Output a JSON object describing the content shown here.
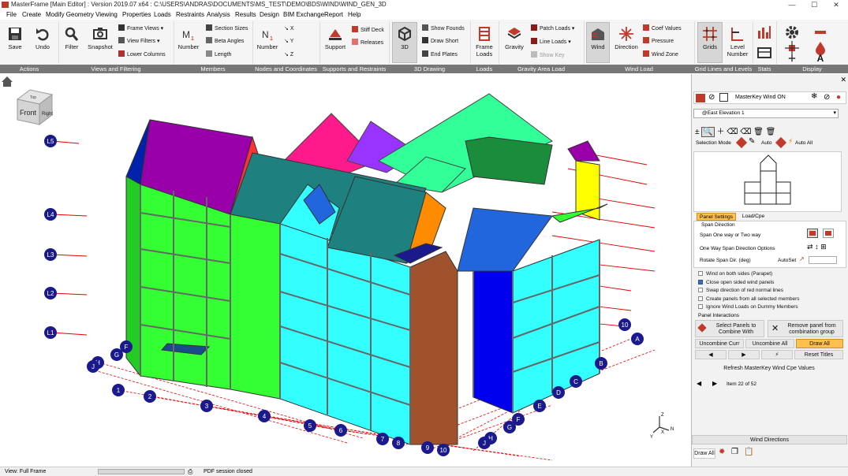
{
  "window": {
    "title": "MasterFrame [Main Editor] : Version 2019.07 x64 : C:\\USERS\\ANDRAS\\DOCUMENTS\\MS_TEST\\DEMO\\BDS\\WIND\\WIND_GEN_3D",
    "minimize": "—",
    "maximize": "☐",
    "close": "✕"
  },
  "menu": [
    "File",
    "Create",
    "Modify Geometry",
    "Viewing",
    "Properties",
    "Loads",
    "Restraints",
    "Analysis",
    "Results",
    "Design",
    "BIM Exchange",
    "Report",
    "Help"
  ],
  "ribbon": {
    "groups": [
      "Actions",
      "Views and Filtering",
      "Members",
      "Nodes and Coordinates",
      "Supports and Restraints",
      "3D Drawing",
      "Loads",
      "Gravity Area Load",
      "Wind Load",
      "Grid Lines and Levels",
      "Stats",
      "Display"
    ],
    "save": "Save",
    "undo": "Undo",
    "filter": "Filter",
    "snapshot": "Snapshot",
    "frame_views": "Frame Views",
    "view_filters": "View Filters",
    "lower_columns": "Lower Columns",
    "number_members": "Number",
    "section_sizes": "Section Sizes",
    "beta_angles": "Beta Angles",
    "length": "Length",
    "number_nodes": "Number",
    "support": "Support",
    "stiff_deck": "Stiff Deck",
    "releases": "Releases",
    "three_d": "3D",
    "show_founds": "Show Founds",
    "draw_short": "Draw Short",
    "end_plates": "End Plates",
    "frame_loads": "Frame Loads",
    "gravity": "Gravity",
    "patch_loads": "Patch Loads",
    "line_loads": "Line Loads",
    "show_key": "Show Key",
    "wind": "Wind",
    "direction": "Direction",
    "coef_values": "Coef Values",
    "pressure": "Pressure",
    "wind_zone": "Wind Zone",
    "grids": "Grids",
    "level_number": "Level Number"
  },
  "viewcube": {
    "top": "Top",
    "front": "Front",
    "right": "Right"
  },
  "levels": [
    "L5",
    "L4",
    "L3",
    "L2",
    "L1"
  ],
  "grid_numbers": [
    "1",
    "2",
    "3",
    "4",
    "5",
    "6",
    "7",
    "8",
    "9",
    "10"
  ],
  "grid_letters": [
    "A",
    "B",
    "C",
    "D",
    "E",
    "F",
    "G",
    "H",
    "J"
  ],
  "axes": {
    "x": "X",
    "y": "Y",
    "z": "Z",
    "n": "N"
  },
  "panel": {
    "title": "MasterKey Wind ON",
    "elevation": "@East Elevation 1",
    "selection_mode_label": "Selection Mode",
    "auto": "Auto",
    "auto_all": "Auto All",
    "tabs": [
      "Panel Settings",
      "Load/Cpe"
    ],
    "span_direction": "Span Direction",
    "span_one_or_two": "Span One way or Two way",
    "one_way_options": "One Way Span Direction Options",
    "rotate_span": "Rotate Span Dir. (deg)",
    "autoset": "AutoSet",
    "checkboxes": [
      {
        "label": "Wind on both sides (Parapet)",
        "checked": false
      },
      {
        "label": "Close open sided wind panels",
        "checked": true
      },
      {
        "label": "Swap direction of red normal lines",
        "checked": false
      },
      {
        "label": "Create panels from all selected members",
        "checked": false
      },
      {
        "label": "Ignore Wind Loads on Dummy Members",
        "checked": false
      }
    ],
    "panel_interactions": "Panel Interactions",
    "select_panels": "Select Panels to Combine With",
    "remove_panel": "Remove panel from combination group",
    "uncombine_curr": "Uncombine Curr",
    "uncombine_all": "Uncombine All",
    "draw_all": "Draw All",
    "reset_titles": "Reset Titles",
    "refresh": "Refresh MasterKey Wind Cpe Values",
    "item_counter": "Item 22 of 52",
    "wind_directions": "Wind Directions",
    "draw_all_bottom": "Draw All"
  },
  "status": {
    "view": "View: Full Frame",
    "message": "PDF session closed"
  },
  "colors": {
    "green": "#33ff33",
    "cyan": "#33ffff",
    "purple": "#9900aa",
    "teal": "#1f8080",
    "magenta": "#ff1a8c",
    "violet": "#9933ff",
    "brown": "#a0522d",
    "blue": "#0000ee",
    "orange": "#ff8c00",
    "yellow": "#ffff00",
    "grid_red": "#e60000",
    "grid_blue": "#1a1a8c"
  }
}
